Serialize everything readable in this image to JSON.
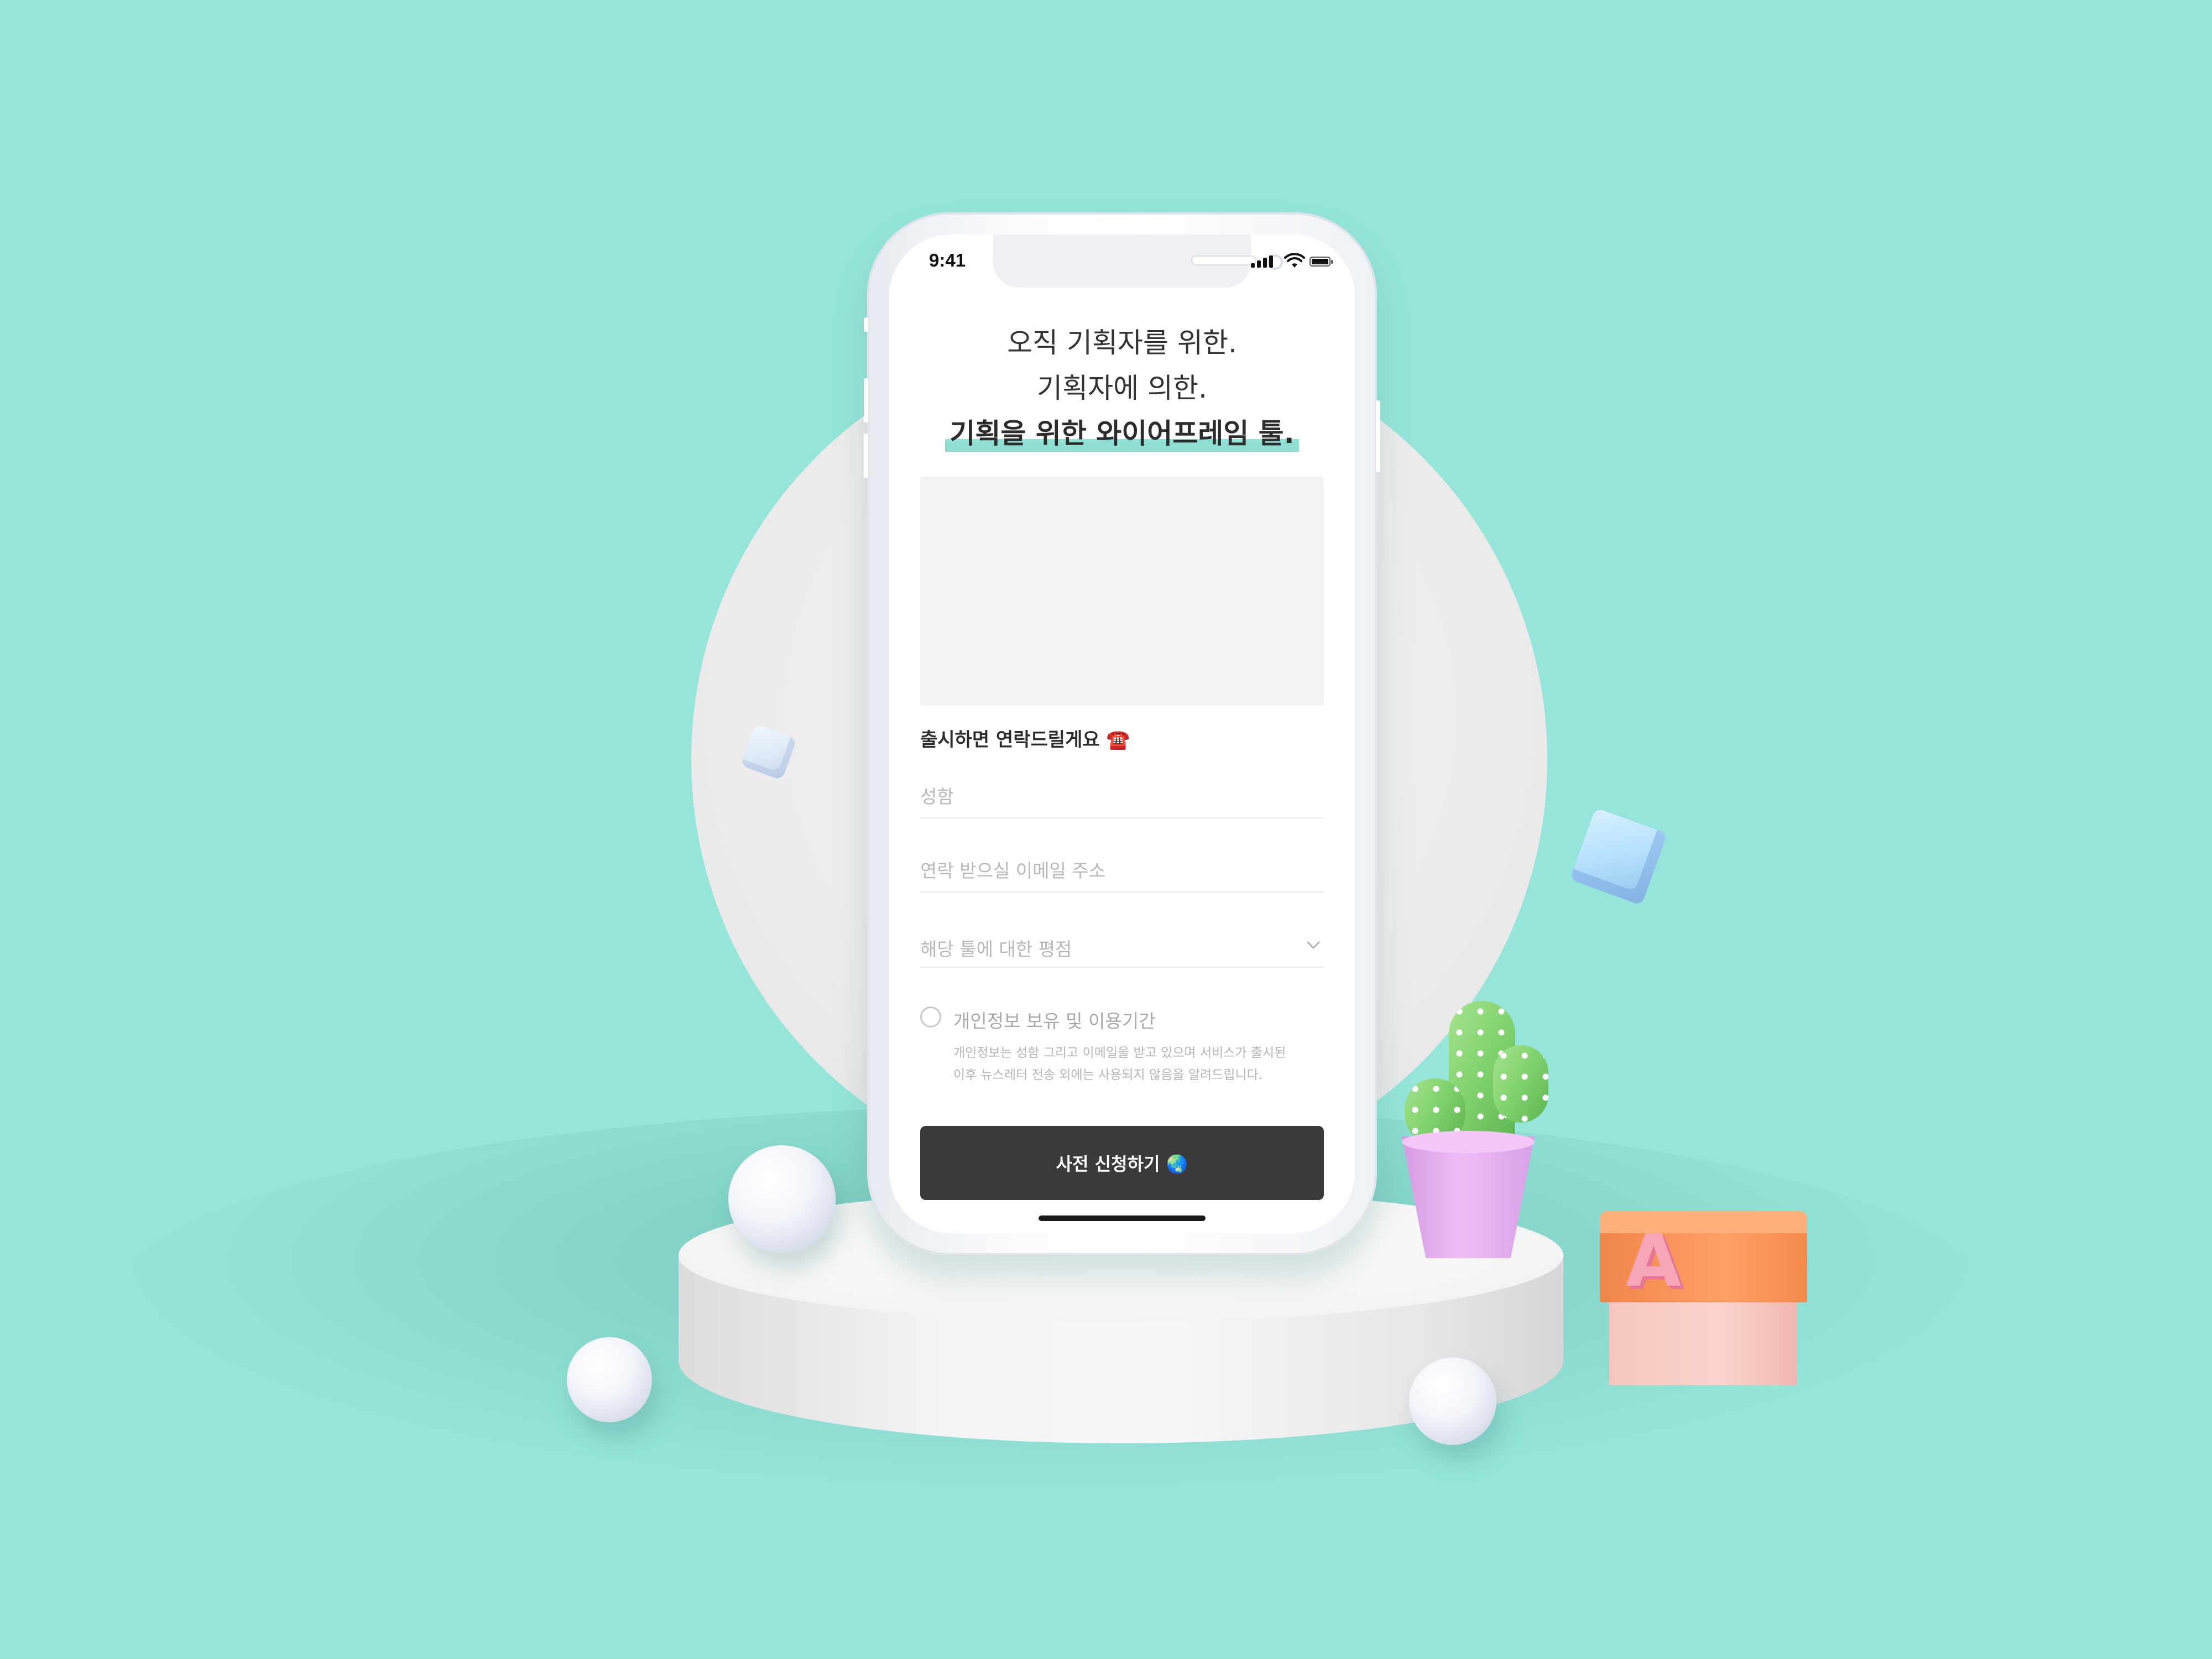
{
  "status_bar": {
    "time": "9:41"
  },
  "headline": {
    "line1": "오직 기획자를 위한.",
    "line2": "기획자에 의한.",
    "line3": "기획을 위한 와이어프레임 툴."
  },
  "form": {
    "section_title": "출시하면 연락드릴게요 ☎️",
    "name_placeholder": "성함",
    "email_placeholder": "연락 받으실 이메일 주소",
    "rating_placeholder": "해당 툴에 대한 평점",
    "consent_label": "개인정보 보유 및 이용기간",
    "consent_desc_line1": "개인정보는 성함 그리고 이메일을 받고 있으며 서비스가 출시된",
    "consent_desc_line2": "이후 뉴스레터 전송 외에는 사용되지 않음을 알려드립니다.",
    "submit_label": "사전 신청하기 🌏"
  },
  "decor": {
    "block_letter": "A"
  },
  "colors": {
    "background": "#95e5da",
    "highlight": "#8fe0d2",
    "button": "#3a3a3a"
  }
}
